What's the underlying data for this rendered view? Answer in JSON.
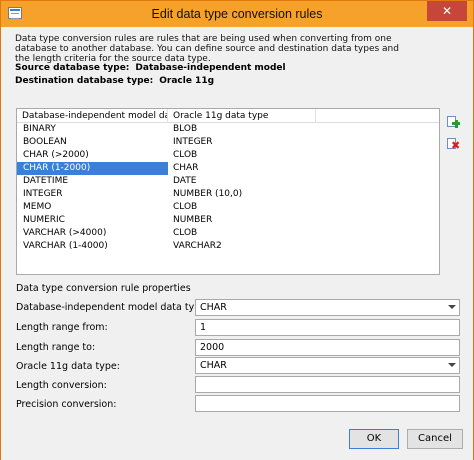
{
  "window": {
    "title": "Edit data type conversion rules",
    "close_glyph": "✕"
  },
  "intro": {
    "description": "Data type conversion rules are rules that are being used when converting from one database to another database. You can define source and destination data types and the length criteria for the source data type.",
    "source_label": "Source database type:",
    "source_value": "Database-independent model",
    "destination_label": "Destination database type:",
    "destination_value": "Oracle 11g"
  },
  "grid": {
    "columns": [
      "Database-independent model dat...",
      "Oracle 11g data type"
    ],
    "selected_index": 3,
    "rows": [
      {
        "source": "BINARY",
        "target": "BLOB"
      },
      {
        "source": "BOOLEAN",
        "target": "INTEGER"
      },
      {
        "source": "CHAR (>2000)",
        "target": "CLOB"
      },
      {
        "source": "CHAR (1-2000)",
        "target": "CHAR"
      },
      {
        "source": "DATETIME",
        "target": "DATE"
      },
      {
        "source": "INTEGER",
        "target": "NUMBER (10,0)"
      },
      {
        "source": "MEMO",
        "target": "CLOB"
      },
      {
        "source": "NUMERIC",
        "target": "NUMBER"
      },
      {
        "source": "VARCHAR (>4000)",
        "target": "CLOB"
      },
      {
        "source": "VARCHAR (1-4000)",
        "target": "VARCHAR2"
      }
    ],
    "icons": {
      "add": "add-rule-icon",
      "delete": "delete-rule-icon"
    }
  },
  "properties": {
    "section_title": "Data type conversion rule properties",
    "source_type_label": "Database-independent model data type:",
    "source_type_value": "CHAR",
    "length_from_label": "Length range from:",
    "length_from_value": "1",
    "length_to_label": "Length range to:",
    "length_to_value": "2000",
    "target_type_label": "Oracle 11g data type:",
    "target_type_value": "CHAR",
    "length_conversion_label": "Length conversion:",
    "length_conversion_value": "",
    "precision_conversion_label": "Precision conversion:",
    "precision_conversion_value": ""
  },
  "footer": {
    "ok_label": "OK",
    "cancel_label": "Cancel"
  },
  "colors": {
    "titlebar": "#f6a12a",
    "selection": "#3c7fd8",
    "close": "#c7463a"
  }
}
